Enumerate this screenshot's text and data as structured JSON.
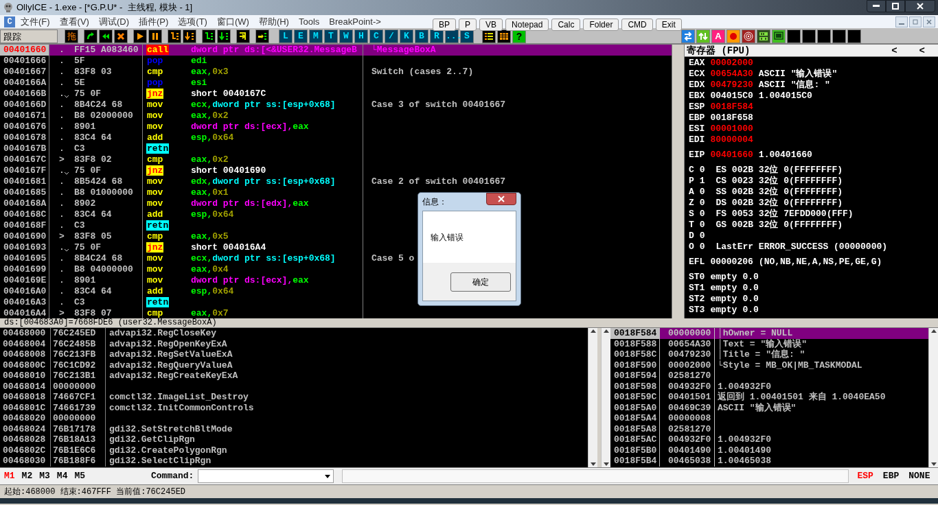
{
  "window": {
    "title": "OllyICE - 1.exe - [*G.P.U* -  主线程, 模块 - 1]"
  },
  "menu": {
    "logo": "C",
    "items": [
      "文件(F)",
      "查看(V)",
      "调试(D)",
      "插件(P)",
      "选项(T)",
      "窗口(W)",
      "帮助(H)",
      "Tools",
      "BreakPoint->"
    ],
    "buttons": [
      "BP",
      "P",
      "VB",
      "Notepad",
      "Calc",
      "Folder",
      "CMD",
      "Exit"
    ]
  },
  "toolbar": {
    "label": "跟踪",
    "drag": "拖",
    "letters": [
      "L",
      "E",
      "M",
      "T",
      "W",
      "H",
      "C",
      "/",
      "K",
      "B",
      "R",
      "...",
      "S"
    ],
    "help": "?",
    "ascii": "A"
  },
  "disasm": {
    "rows": [
      {
        "address": "00401660",
        "mark": ".",
        "jump": false,
        "hex": "FF15 A083460",
        "mnemonic": "call",
        "operands": [
          {
            "text": "dword ptr ds:[<&USER32.MessageB",
            "kind": "mem"
          }
        ],
        "comment": "└MessageBoxA",
        "selected": true
      },
      {
        "address": "00401666",
        "mark": ".",
        "jump": false,
        "hex": "5F",
        "mnemonic": "pop",
        "operands": [
          {
            "text": "edi",
            "kind": "reg"
          }
        ],
        "selected": false
      },
      {
        "address": "00401667",
        "mark": ".",
        "jump": false,
        "hex": "83F8 03",
        "mnemonic": "cmp",
        "operands": [
          {
            "text": "eax,",
            "kind": "reg"
          },
          {
            "text": "0x3",
            "kind": "imm"
          }
        ],
        "comment": "Switch (cases 2..7)",
        "selected": false
      },
      {
        "address": "0040166A",
        "mark": ".",
        "jump": false,
        "hex": "5E",
        "mnemonic": "pop",
        "operands": [
          {
            "text": "esi",
            "kind": "reg"
          }
        ],
        "selected": false
      },
      {
        "address": "0040166B",
        "mark": ".",
        "jump": true,
        "hex": "75 0F",
        "mnemonic": "jnz",
        "operands": [
          {
            "text": "short 0040167C",
            "kind": "plain"
          }
        ],
        "selected": false
      },
      {
        "address": "0040166D",
        "mark": ".",
        "jump": false,
        "hex": "8B4C24 68",
        "mnemonic": "mov",
        "operands": [
          {
            "text": "ecx,",
            "kind": "reg"
          },
          {
            "text": "dword ptr ss:[esp+0x68]",
            "kind": "stack"
          }
        ],
        "comment": "Case 3 of switch 00401667",
        "selected": false
      },
      {
        "address": "00401671",
        "mark": ".",
        "jump": false,
        "hex": "B8 02000000",
        "mnemonic": "mov",
        "operands": [
          {
            "text": "eax,",
            "kind": "reg"
          },
          {
            "text": "0x2",
            "kind": "imm"
          }
        ],
        "selected": false
      },
      {
        "address": "00401676",
        "mark": ".",
        "jump": false,
        "hex": "8901",
        "mnemonic": "mov",
        "operands": [
          {
            "text": "dword ptr ds:[ecx],",
            "kind": "mem"
          },
          {
            "text": "eax",
            "kind": "reg"
          }
        ],
        "selected": false
      },
      {
        "address": "00401678",
        "mark": ".",
        "jump": false,
        "hex": "83C4 64",
        "mnemonic": "add",
        "operands": [
          {
            "text": "esp,",
            "kind": "reg"
          },
          {
            "text": "0x64",
            "kind": "imm"
          }
        ],
        "selected": false
      },
      {
        "address": "0040167B",
        "mark": ".",
        "jump": false,
        "hex": "C3",
        "mnemonic": "retn",
        "operands": [],
        "selected": false
      },
      {
        "address": "0040167C",
        "mark": ">",
        "jump": false,
        "hex": "83F8 02",
        "mnemonic": "cmp",
        "operands": [
          {
            "text": "eax,",
            "kind": "reg"
          },
          {
            "text": "0x2",
            "kind": "imm"
          }
        ],
        "selected": false
      },
      {
        "address": "0040167F",
        "mark": ".",
        "jump": true,
        "hex": "75 0F",
        "mnemonic": "jnz",
        "operands": [
          {
            "text": "short 00401690",
            "kind": "plain"
          }
        ],
        "selected": false
      },
      {
        "address": "00401681",
        "mark": ".",
        "jump": false,
        "hex": "8B5424 68",
        "mnemonic": "mov",
        "operands": [
          {
            "text": "edx,",
            "kind": "reg"
          },
          {
            "text": "dword ptr ss:[esp+0x68]",
            "kind": "stack"
          }
        ],
        "comment": "Case 2 of switch 00401667",
        "selected": false
      },
      {
        "address": "00401685",
        "mark": ".",
        "jump": false,
        "hex": "B8 01000000",
        "mnemonic": "mov",
        "operands": [
          {
            "text": "eax,",
            "kind": "reg"
          },
          {
            "text": "0x1",
            "kind": "imm"
          }
        ],
        "selected": false
      },
      {
        "address": "0040168A",
        "mark": ".",
        "jump": false,
        "hex": "8902",
        "mnemonic": "mov",
        "operands": [
          {
            "text": "dword ptr ds:[edx],",
            "kind": "mem"
          },
          {
            "text": "eax",
            "kind": "reg"
          }
        ],
        "selected": false
      },
      {
        "address": "0040168C",
        "mark": ".",
        "jump": false,
        "hex": "83C4 64",
        "mnemonic": "add",
        "operands": [
          {
            "text": "esp,",
            "kind": "reg"
          },
          {
            "text": "0x64",
            "kind": "imm"
          }
        ],
        "selected": false
      },
      {
        "address": "0040168F",
        "mark": ".",
        "jump": false,
        "hex": "C3",
        "mnemonic": "retn",
        "operands": [],
        "selected": false
      },
      {
        "address": "00401690",
        "mark": ">",
        "jump": false,
        "hex": "83F8 05",
        "mnemonic": "cmp",
        "operands": [
          {
            "text": "eax,",
            "kind": "reg"
          },
          {
            "text": "0x5",
            "kind": "imm"
          }
        ],
        "selected": false
      },
      {
        "address": "00401693",
        "mark": ".",
        "jump": true,
        "hex": "75 0F",
        "mnemonic": "jnz",
        "operands": [
          {
            "text": "short 004016A4",
            "kind": "plain"
          }
        ],
        "selected": false
      },
      {
        "address": "00401695",
        "mark": ".",
        "jump": false,
        "hex": "8B4C24 68",
        "mnemonic": "mov",
        "operands": [
          {
            "text": "ecx,",
            "kind": "reg"
          },
          {
            "text": "dword ptr ss:[esp+0x68]",
            "kind": "stack"
          }
        ],
        "comment": "Case 5 o",
        "selected": false
      },
      {
        "address": "00401699",
        "mark": ".",
        "jump": false,
        "hex": "B8 04000000",
        "mnemonic": "mov",
        "operands": [
          {
            "text": "eax,",
            "kind": "reg"
          },
          {
            "text": "0x4",
            "kind": "imm"
          }
        ],
        "selected": false
      },
      {
        "address": "0040169E",
        "mark": ".",
        "jump": false,
        "hex": "8901",
        "mnemonic": "mov",
        "operands": [
          {
            "text": "dword ptr ds:[ecx],",
            "kind": "mem"
          },
          {
            "text": "eax",
            "kind": "reg"
          }
        ],
        "selected": false
      },
      {
        "address": "004016A0",
        "mark": ".",
        "jump": false,
        "hex": "83C4 64",
        "mnemonic": "add",
        "operands": [
          {
            "text": "esp,",
            "kind": "reg"
          },
          {
            "text": "0x64",
            "kind": "imm"
          }
        ],
        "selected": false
      },
      {
        "address": "004016A3",
        "mark": ".",
        "jump": false,
        "hex": "C3",
        "mnemonic": "retn",
        "operands": [],
        "selected": false
      },
      {
        "address": "004016A4",
        "mark": ">",
        "jump": false,
        "hex": "83F8 07",
        "mnemonic": "cmp",
        "operands": [
          {
            "text": "eax,",
            "kind": "reg"
          },
          {
            "text": "0x7",
            "kind": "imm"
          }
        ],
        "selected": false
      }
    ]
  },
  "info_line": "ds:[004683A0]=7668FDE6 (user32.MessageBoxA)",
  "registers": {
    "title": "寄存器 (FPU)",
    "arrows": [
      "<",
      "<"
    ],
    "sections": [
      [
        {
          "name": "EAX",
          "value": "00002000",
          "changed": true
        },
        {
          "name": "ECX",
          "value": "00654A30",
          "changed": true,
          "note": "ASCII \"输入错误\""
        },
        {
          "name": "EDX",
          "value": "00479230",
          "changed": true,
          "note": "ASCII \"信息: \""
        },
        {
          "name": "EBX",
          "value": "004015C0",
          "changed": false,
          "note": "1.004015C0"
        },
        {
          "name": "ESP",
          "value": "0018F584",
          "changed": true
        },
        {
          "name": "EBP",
          "value": "0018F658",
          "changed": false
        },
        {
          "name": "ESI",
          "value": "00001000",
          "changed": true
        },
        {
          "name": "EDI",
          "value": "80000004",
          "changed": true
        }
      ],
      [
        {
          "name": "EIP",
          "value": "00401660",
          "changed": true,
          "note": "1.00401660"
        }
      ],
      [
        {
          "name": "C",
          "value": "0",
          "changed": false,
          "note": " ES 002B 32位 0(FFFFFFFF)"
        },
        {
          "name": "P",
          "value": "1",
          "changed": false,
          "note": " CS 0023 32位 0(FFFFFFFF)"
        },
        {
          "name": "A",
          "value": "0",
          "changed": false,
          "note": " SS 002B 32位 0(FFFFFFFF)"
        },
        {
          "name": "Z",
          "value": "0",
          "changed": false,
          "note": " DS 002B 32位 0(FFFFFFFF)"
        },
        {
          "name": "S",
          "value": "0",
          "changed": false,
          "note": " FS 0053 32位 7EFDD000(FFF)"
        },
        {
          "name": "T",
          "value": "0",
          "changed": false,
          "note": " GS 002B 32位 0(FFFFFFFF)"
        },
        {
          "name": "D",
          "value": "0",
          "changed": false
        },
        {
          "name": "O",
          "value": "0",
          "changed": false,
          "note": " LastErr ERROR_SUCCESS (00000000)"
        }
      ],
      [
        {
          "name": "EFL",
          "value": "00000206",
          "changed": false,
          "note": "(NO,NB,NE,A,NS,PE,GE,G)"
        }
      ],
      [
        {
          "name": "ST0",
          "value": "empty",
          "changed": false,
          "note": "0.0"
        },
        {
          "name": "ST1",
          "value": "empty",
          "changed": false,
          "note": "0.0"
        },
        {
          "name": "ST2",
          "value": "empty",
          "changed": false,
          "note": "0.0"
        },
        {
          "name": "ST3",
          "value": "empty",
          "changed": false,
          "note": "0.0"
        }
      ]
    ]
  },
  "dump": {
    "rows": [
      {
        "address": "00468000",
        "value": "76C245ED",
        "comment": "advapi32.RegCloseKey"
      },
      {
        "address": "00468004",
        "value": "76C2485B",
        "comment": "advapi32.RegOpenKeyExA"
      },
      {
        "address": "00468008",
        "value": "76C213FB",
        "comment": "advapi32.RegSetValueExA"
      },
      {
        "address": "0046800C",
        "value": "76C1CD92",
        "comment": "advapi32.RegQueryValueA"
      },
      {
        "address": "00468010",
        "value": "76C213B1",
        "comment": "advapi32.RegCreateKeyExA"
      },
      {
        "address": "00468014",
        "value": "00000000"
      },
      {
        "address": "00468018",
        "value": "74667CF1",
        "comment": "comctl32.ImageList_Destroy"
      },
      {
        "address": "0046801C",
        "value": "74661739",
        "comment": "comctl32.InitCommonControls"
      },
      {
        "address": "00468020",
        "value": "00000000"
      },
      {
        "address": "00468024",
        "value": "76B17178",
        "comment": "gdi32.SetStretchBltMode"
      },
      {
        "address": "00468028",
        "value": "76B18A13",
        "comment": "gdi32.GetClipRgn"
      },
      {
        "address": "0046802C",
        "value": "76B1E6C6",
        "comment": "gdi32.CreatePolygonRgn"
      },
      {
        "address": "00468030",
        "value": "76B188F6",
        "comment": "gdi32.SelectClipRgn"
      }
    ]
  },
  "stack": {
    "rows": [
      {
        "address": "0018F584",
        "value": "00000000",
        "comment": "│hOwner = NULL",
        "selected": true
      },
      {
        "address": "0018F588",
        "value": "00654A30",
        "comment": "│Text = \"输入错误\"",
        "selected": false
      },
      {
        "address": "0018F58C",
        "value": "00479230",
        "comment": "│Title = \"信息: \"",
        "selected": false
      },
      {
        "address": "0018F590",
        "value": "00002000",
        "comment": "└Style = MB_OK|MB_TASKMODAL",
        "selected": false
      },
      {
        "address": "0018F594",
        "value": "02581270",
        "selected": false
      },
      {
        "address": "0018F598",
        "value": "004932F0",
        "comment": "1.004932F0",
        "selected": false
      },
      {
        "address": "0018F59C",
        "value": "00401501",
        "comment": "返回到 1.00401501 来自 1.0040EA50",
        "selected": false
      },
      {
        "address": "0018F5A0",
        "value": "00469C39",
        "comment": "ASCII \"输入错误\"",
        "selected": false
      },
      {
        "address": "0018F5A4",
        "value": "00000008",
        "selected": false
      },
      {
        "address": "0018F5A8",
        "value": "02581270",
        "selected": false
      },
      {
        "address": "0018F5AC",
        "value": "004932F0",
        "comment": "1.004932F0",
        "selected": false
      },
      {
        "address": "0018F5B0",
        "value": "00401490",
        "comment": "1.00401490",
        "selected": false
      },
      {
        "address": "0018F5B4",
        "value": "00465038",
        "comment": "1.00465038",
        "selected": false
      }
    ]
  },
  "command_bar": {
    "dumps": [
      {
        "label": "M1",
        "selected": true
      },
      {
        "label": "M2",
        "selected": false
      },
      {
        "label": "M3",
        "selected": false
      },
      {
        "label": "M4",
        "selected": false
      },
      {
        "label": "M5",
        "selected": false
      }
    ],
    "command_label": "Command:",
    "frames": [
      {
        "label": "ESP",
        "selected": true
      },
      {
        "label": "EBP",
        "selected": false
      },
      {
        "label": "NONE",
        "selected": false
      }
    ]
  },
  "status_bar": "起始:468000 结束:467FFF 当前值:76C245ED",
  "dialog": {
    "title": "信息：",
    "message": "输入错误",
    "button": "确定"
  }
}
